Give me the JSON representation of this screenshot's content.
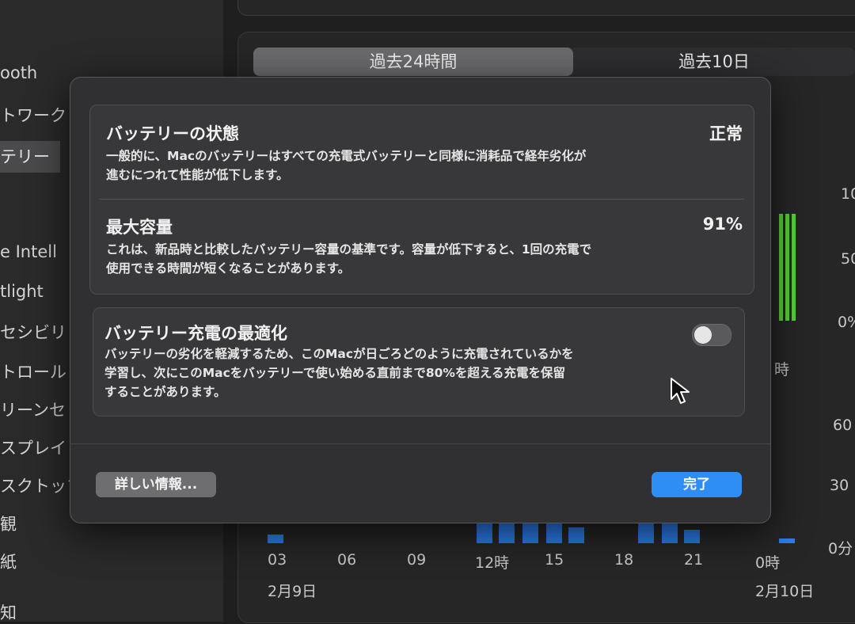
{
  "sidebar": {
    "items": [
      {
        "label": "ooth"
      },
      {
        "label": "トワーク"
      },
      {
        "label": "テリー",
        "selected": true
      },
      {
        "label": "e Intell"
      },
      {
        "label": "tlight"
      },
      {
        "label": "セシビリ"
      },
      {
        "label": "トロール"
      },
      {
        "label": "リーンセ"
      },
      {
        "label": "スプレイ"
      },
      {
        "label": "スクトップ"
      },
      {
        "label": "観"
      },
      {
        "label": "紙"
      },
      {
        "label": "知"
      }
    ]
  },
  "range_tabs": {
    "active": "過去24時間",
    "inactive": "過去10日"
  },
  "charts": {
    "level_axis": [
      "10",
      "50",
      "0%"
    ],
    "time_label": "時",
    "usage_axis": [
      "60",
      "30",
      "0分"
    ],
    "x_ticks": [
      "03",
      "06",
      "09",
      "12時",
      "15",
      "18",
      "21",
      "0時"
    ],
    "dates": [
      "2月9日",
      "2月10日"
    ],
    "accent_green": "#5fd13a",
    "accent_blue": "#2d7ef0"
  },
  "dialog": {
    "health": {
      "title": "バッテリーの状態",
      "value": "正常",
      "description_line1": "一般的に、Macのバッテリーはすべての充電式バッテリーと同様に消耗品で経年劣化が",
      "description_line2": "進むにつれて性能が低下します。"
    },
    "capacity": {
      "title": "最大容量",
      "value": "91%",
      "description_line1": "これは、新品時と比較したバッテリー容量の基準です。容量が低下すると、1回の充電で",
      "description_line2": "使用できる時間が短くなることがあります。"
    },
    "optimize": {
      "title": "バッテリー充電の最適化",
      "enabled": false,
      "description_line1": "バッテリーの劣化を軽減するため、このMacが日ごろどのように充電されているかを",
      "description_line2": "学習し、次にこのMacをバッテリーで使い始める直前まで80%を超える充電を保留",
      "description_line3": "することがあります。"
    },
    "more_info_button": "詳しい情報...",
    "done_button": "完了",
    "accent": "#2f8ef6"
  }
}
